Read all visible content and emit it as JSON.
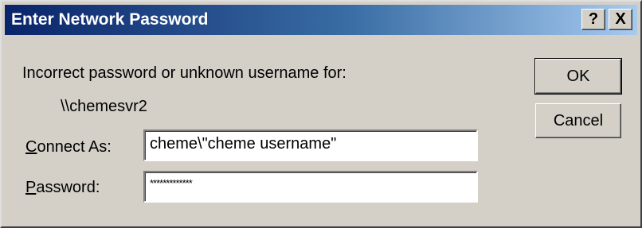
{
  "window": {
    "title": "Enter Network Password",
    "help_button": "?",
    "close_button": "X"
  },
  "message": {
    "line1": "Incorrect password or unknown username for:",
    "server": "\\\\chemesvr2"
  },
  "fields": {
    "connect_as": {
      "label_accel": "C",
      "label_rest": "onnect As:",
      "value": "cheme\\\"cheme username\""
    },
    "password": {
      "label_accel": "P",
      "label_rest": "assword:",
      "value": "*************"
    }
  },
  "buttons": {
    "ok": "OK",
    "cancel": "Cancel"
  }
}
